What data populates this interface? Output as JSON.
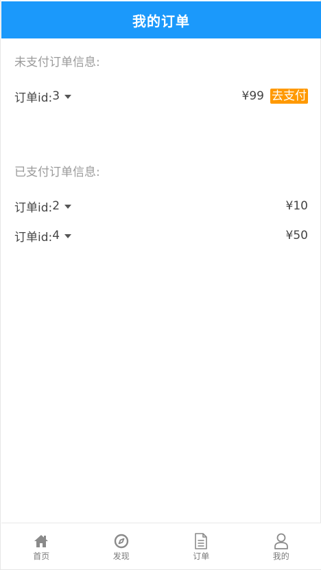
{
  "header": {
    "title": "我的订单"
  },
  "unpaid": {
    "title": "未支付订单信息:",
    "orders": [
      {
        "label": "订单id:",
        "id": "3",
        "price": "¥99",
        "action": "去支付"
      }
    ]
  },
  "paid": {
    "title": "已支付订单信息:",
    "orders": [
      {
        "label": "订单id:",
        "id": "2",
        "price": "¥10"
      },
      {
        "label": "订单id:",
        "id": "4",
        "price": "¥50"
      }
    ]
  },
  "tabbar": {
    "items": [
      {
        "label": "首页",
        "icon": "home-icon"
      },
      {
        "label": "发现",
        "icon": "compass-icon"
      },
      {
        "label": "订单",
        "icon": "document-icon"
      },
      {
        "label": "我的",
        "icon": "user-icon"
      }
    ]
  },
  "colors": {
    "header": "#1b99fb",
    "pay_button": "#ff9900",
    "muted_text": "#9a9a9a",
    "body_text": "#444444"
  }
}
